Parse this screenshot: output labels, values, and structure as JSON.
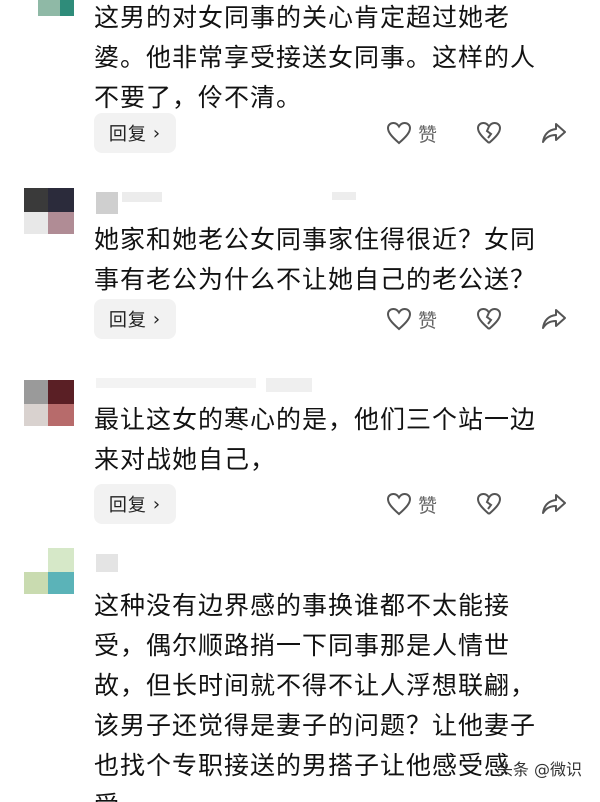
{
  "comments": [
    {
      "text_lines": [
        "这男的对女同事的关心肯定超过她老",
        "婆。他非常享受接送女同事。这样的人",
        "不要了，伶不清。"
      ],
      "reply_label": "回复",
      "like_label": "赞"
    },
    {
      "text_lines": [
        "她家和她老公女同事家住得很近？女同",
        "事有老公为什么不让她自己的老公送？"
      ],
      "reply_label": "回复",
      "like_label": "赞"
    },
    {
      "text_lines": [
        "最让这女的寒心的是，他们三个站一边",
        "来对战她自己，"
      ],
      "reply_label": "回复",
      "like_label": "赞"
    },
    {
      "text_lines": [
        "这种没有边界感的事换谁都不太能接",
        "受，偶尔顺路捎一下同事那是人情世",
        "故，但长时间就不得不让人浮想联翩，",
        "该男子还觉得是妻子的问题？让他妻子",
        "也找个专职接送的男搭子让他感受感",
        "受。"
      ]
    }
  ],
  "watermark": "头条 @微识",
  "icons": {
    "like": "heart-outline-icon",
    "dislike": "broken-heart-icon",
    "share": "share-arrow-icon",
    "reply_chevron": "chevron-right-icon"
  },
  "colors": {
    "text": "#121212",
    "icon": "#555555",
    "reply_bg": "#f2f2f2"
  }
}
